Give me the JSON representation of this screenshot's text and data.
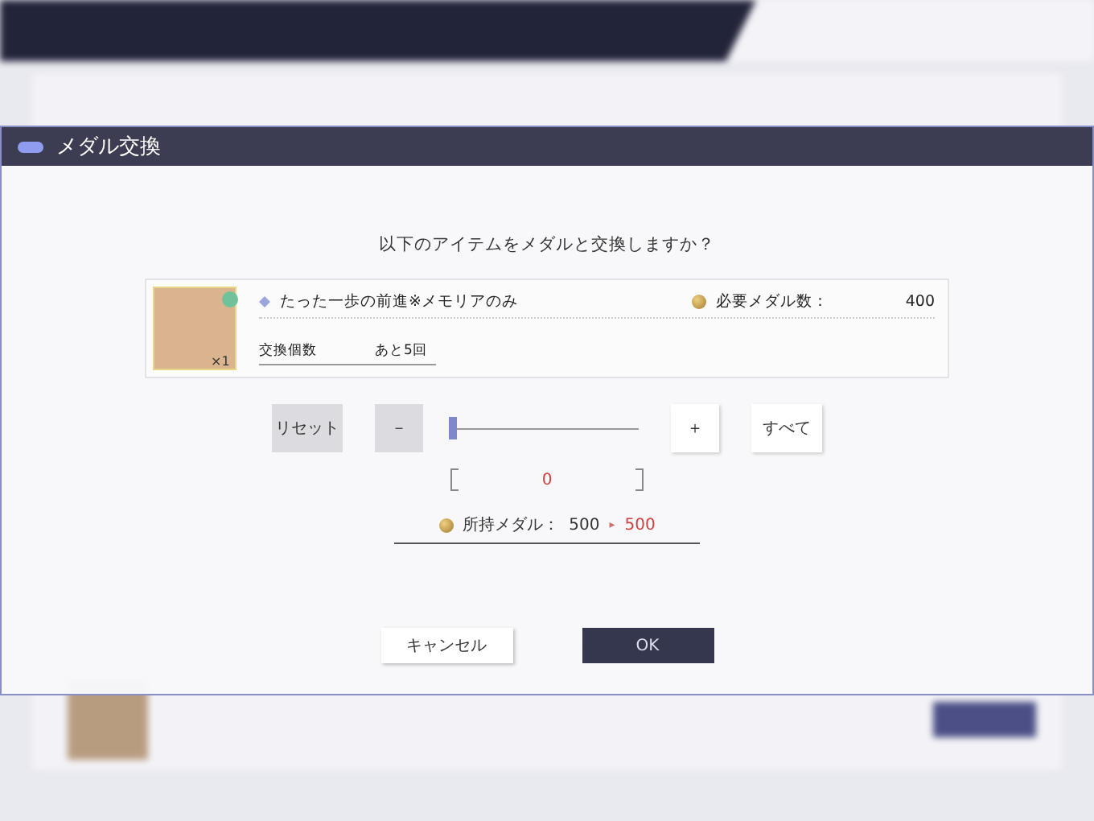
{
  "dialog": {
    "title": "メダル交換",
    "question": "以下のアイテムをメダルと交換しますか？",
    "item": {
      "name": "たった一歩の前進※メモリアのみ",
      "quantity": "×1",
      "cost_label": "必要メダル数：",
      "cost": "400",
      "count_label": "交換個数",
      "remaining": "あと5回"
    },
    "controls": {
      "reset": "リセット",
      "minus": "－",
      "plus": "＋",
      "all": "すべて",
      "level": 0,
      "count": "0"
    },
    "balance": {
      "label": "所持メダル：",
      "current": "500",
      "arrow": "▸",
      "after": "500"
    },
    "buttons": [
      {
        "label": "キャンセル",
        "kind": "secondary"
      },
      {
        "label": "OK",
        "kind": "primary"
      }
    ]
  }
}
